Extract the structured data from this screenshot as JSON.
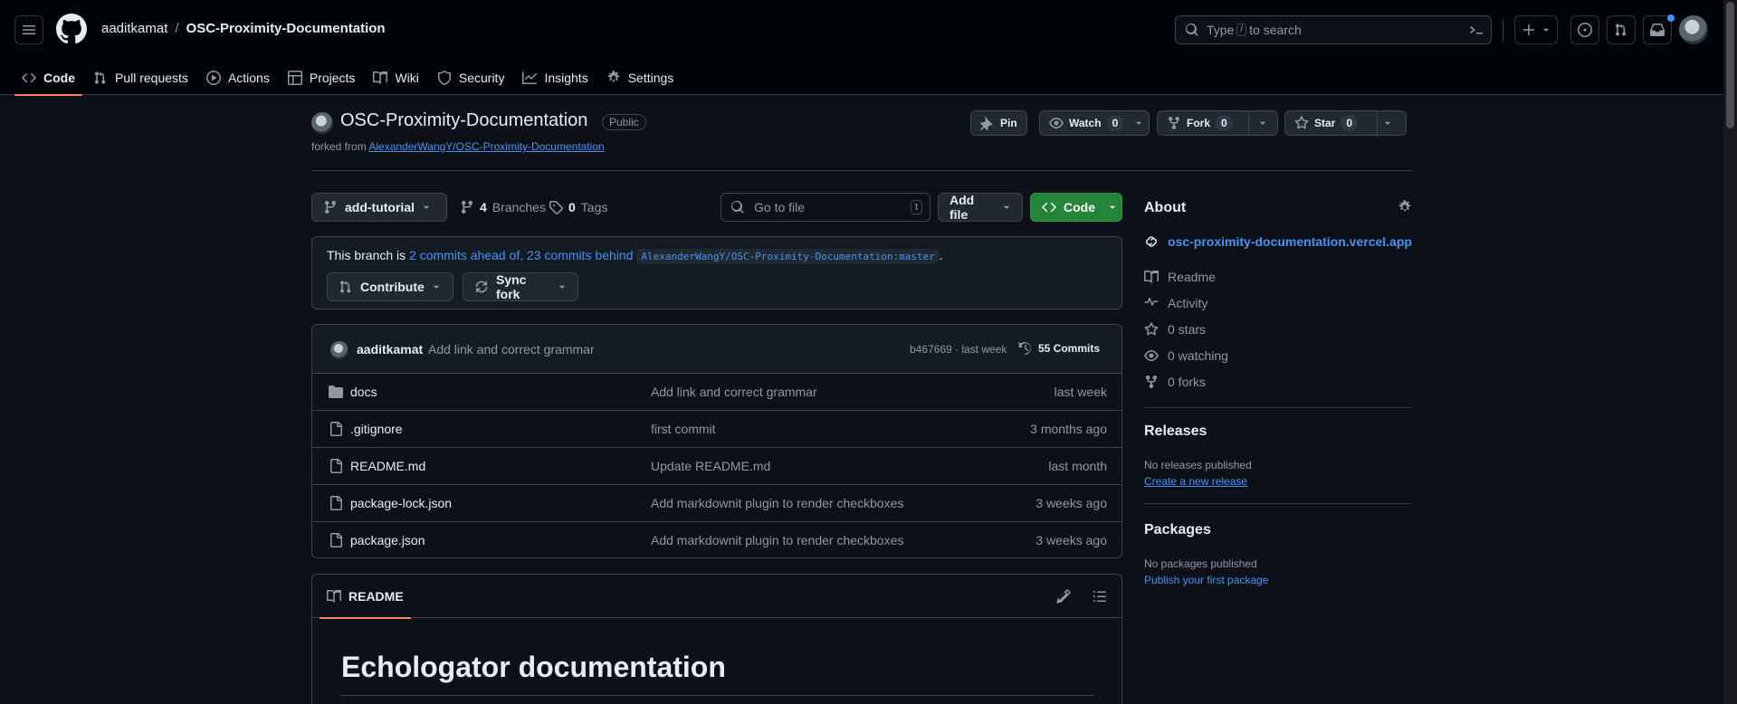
{
  "header": {
    "owner": "aaditkamat",
    "separator": "/",
    "repo": "OSC-Proximity-Documentation",
    "search": {
      "prefix": "Type",
      "key": "/",
      "suffix": "to search"
    }
  },
  "tabs": [
    {
      "label": "Code",
      "icon": "code-icon"
    },
    {
      "label": "Pull requests",
      "icon": "pull-request-icon"
    },
    {
      "label": "Actions",
      "icon": "play-icon"
    },
    {
      "label": "Projects",
      "icon": "table-icon"
    },
    {
      "label": "Wiki",
      "icon": "book-icon"
    },
    {
      "label": "Security",
      "icon": "shield-icon"
    },
    {
      "label": "Insights",
      "icon": "graph-icon"
    },
    {
      "label": "Settings",
      "icon": "gear-icon"
    }
  ],
  "repo_head": {
    "name": "OSC-Proximity-Documentation",
    "visibility": "Public",
    "forked_prefix": "forked from",
    "forked_source": "AlexanderWangY/OSC-Proximity-Documentation",
    "pin": "Pin",
    "watch": {
      "label": "Watch",
      "count": "0"
    },
    "fork": {
      "label": "Fork",
      "count": "0"
    },
    "star": {
      "label": "Star",
      "count": "0"
    }
  },
  "toolbar": {
    "branch": "add-tutorial",
    "branches_count": "4",
    "branches_label": "Branches",
    "tags_count": "0",
    "tags_label": "Tags",
    "goto_placeholder": "Go to file",
    "goto_key": "t",
    "add_file": "Add file",
    "code": "Code"
  },
  "branch_status": {
    "prefix": "This branch is",
    "ahead": "2 commits ahead of,",
    "behind": "23 commits behind",
    "ref": "AlexanderWangY/OSC-Proximity-Documentation:master",
    "suffix": ".",
    "contribute": "Contribute",
    "sync": "Sync fork"
  },
  "latest_commit": {
    "author": "aaditkamat",
    "message": "Add link and correct grammar",
    "meta": "b467669 · last week",
    "commits": "55 Commits"
  },
  "files": [
    {
      "type": "folder",
      "name": "docs",
      "message": "Add link and correct grammar",
      "date": "last week"
    },
    {
      "type": "file",
      "name": ".gitignore",
      "message": "first commit",
      "date": "3 months ago"
    },
    {
      "type": "file",
      "name": "README.md",
      "message": "Update README.md",
      "date": "last month"
    },
    {
      "type": "file",
      "name": "package-lock.json",
      "message": "Add markdownit plugin to render checkboxes",
      "date": "3 weeks ago"
    },
    {
      "type": "file",
      "name": "package.json",
      "message": "Add markdownit plugin to render checkboxes",
      "date": "3 weeks ago"
    }
  ],
  "readme": {
    "tab": "README",
    "title": "Echologator documentation"
  },
  "about": {
    "title": "About",
    "website": "osc-proximity-documentation.vercel.app",
    "readme": "Readme",
    "activity": "Activity",
    "stars": "0 stars",
    "watching": "0 watching",
    "forks": "0 forks"
  },
  "releases": {
    "title": "Releases",
    "empty": "No releases published",
    "link": "Create a new release"
  },
  "packages": {
    "title": "Packages",
    "empty": "No packages published",
    "link": "Publish your first package"
  },
  "colors": {
    "background": "#0d1117",
    "header": "#010409",
    "accent_link": "#4493f8",
    "tab_underline": "#f78166",
    "code_button": "#238636"
  }
}
